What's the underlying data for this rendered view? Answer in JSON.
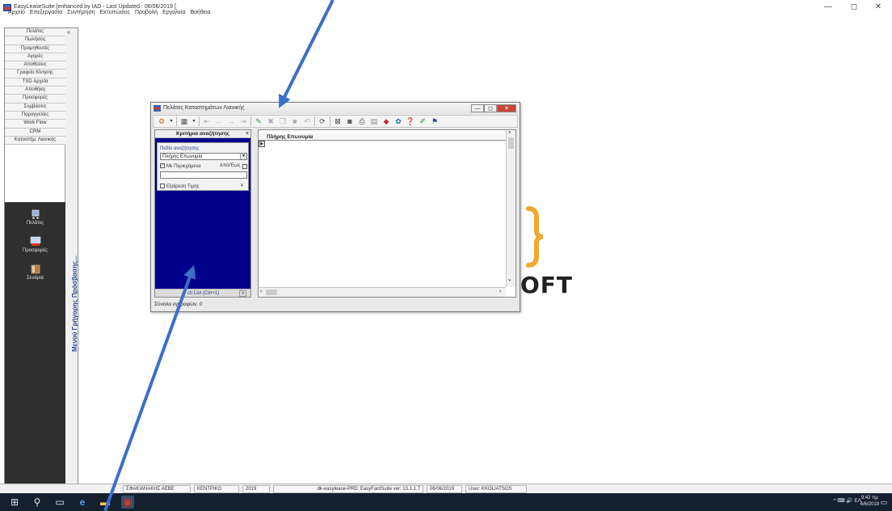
{
  "app": {
    "title": "EasyLeaseSuite [enhanced by IAD - Last Updated : 06/06/2019 ]",
    "window_controls": [
      "—",
      "◻",
      "✕"
    ]
  },
  "menu": [
    "Αρχείο",
    "Επεξεργασία",
    "Συντήρηση",
    "Εκτυπώσεις",
    "Προβολή",
    "Εργαλεία",
    "Βοήθεια"
  ],
  "sidebar": {
    "collapse_label": "«",
    "items": [
      "Πελάτες",
      "Πωλήσεις",
      "Προμηθευτές",
      "Αγορές",
      "Αποθέσεις",
      "Γραφείο Κίνησης",
      "TSD Αρχεία",
      "Αποθήκη",
      "Προσφορές",
      "Συμβάσεις",
      "Παραγγελίες",
      "Work Flow",
      "CRM",
      "Καταστήμ. Λιανικής"
    ],
    "big_items": [
      {
        "label": "Πελάτες",
        "icon": "cart-icon"
      },
      {
        "label": "Προσφορές",
        "icon": "monitor-icon"
      },
      {
        "label": "Σενάρια",
        "icon": "book-icon"
      }
    ],
    "quick_menu_label": "Μενού Γρήγορης Πρόσβασης..."
  },
  "inner_window": {
    "title": "Πελάτες Καταστημάτων Λιανικής",
    "controls": [
      "—",
      "◻",
      "✕"
    ],
    "criteria": {
      "header": "Κριτήρια αναζήτησης",
      "close": "×",
      "field_label": "Πεδία αναζήτησης",
      "field_value": "Πλήρης Επωνυμία",
      "contains_label": "Με Περιεχόμενα",
      "contains_checked": true,
      "range_label": "Από/Έως",
      "exclude_label": "Εξαίρεση Τιμής",
      "footer_visible": "ch List (Ctrl+1)",
      "footer_more": "»"
    },
    "grid": {
      "column": "Πλήρης Επωνυμία"
    },
    "status_visible": "Σύνολο εγγραφών: 0"
  },
  "logo": {
    "text": "OFT",
    "brace_color": "#f0a830"
  },
  "statusbar": [
    "ΣΦΑΚΙΑΝΑΚΗΣ ΑΕΒΕ",
    "ΚΕΝΤΡΙΚΟ",
    "2019",
    "dk-easylease-PRD: EasyFantSuite ver: 13.1.1.7",
    "06/06/2019",
    "User: KKOLIATSOS"
  ],
  "taskbar": {
    "tray_text": "^ ⌨ 🔊 ΕΛ",
    "time": "9:42 πμ",
    "date": "6/6/2019"
  },
  "colors": {
    "criteria_bg": "#00008b",
    "sidebar_dark": "#2f2f2f",
    "taskbar": "#14202e",
    "arrow": "#3b6fc9"
  }
}
